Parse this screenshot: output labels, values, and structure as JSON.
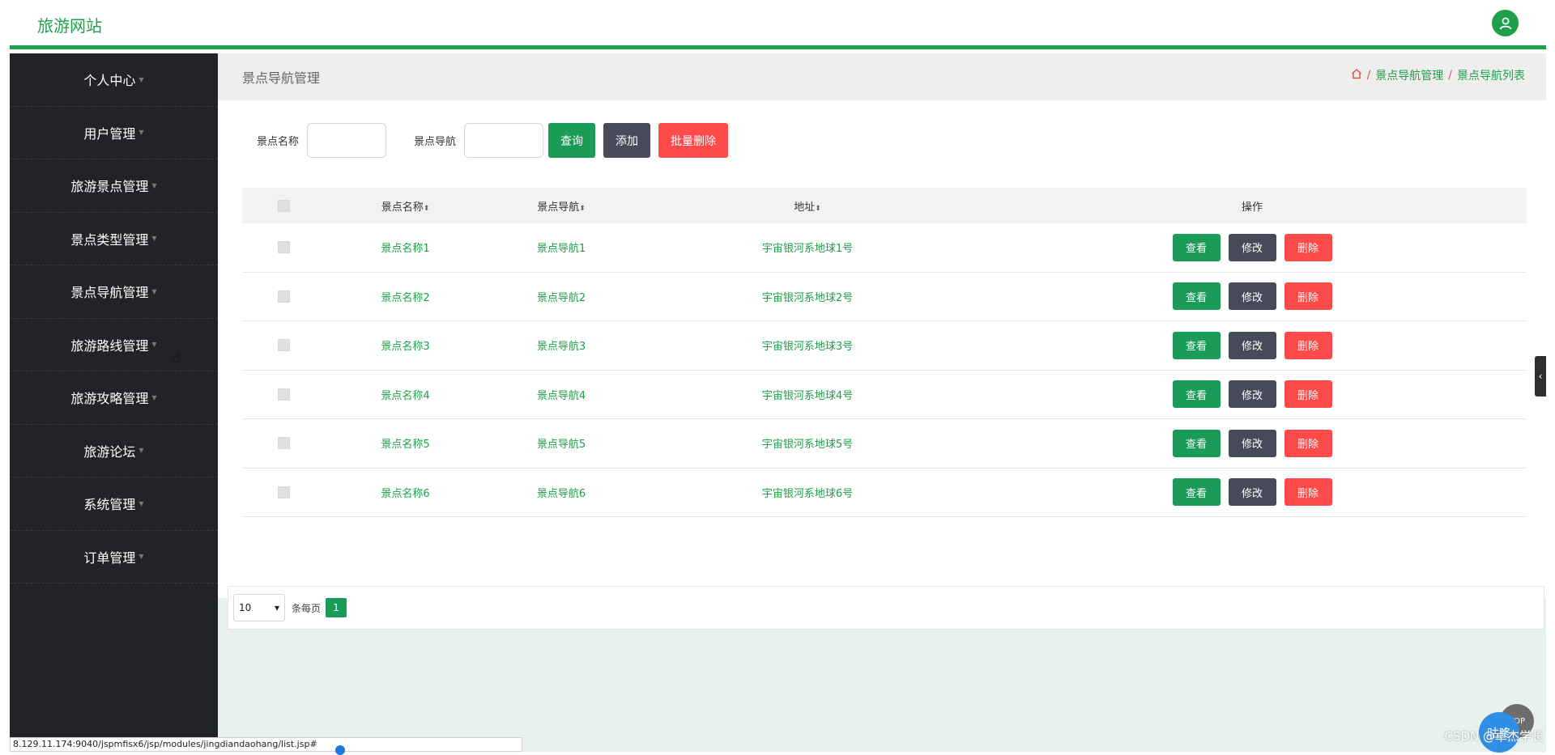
{
  "brand": "旅游网站",
  "sidebar": {
    "items": [
      {
        "label": "个人中心"
      },
      {
        "label": "用户管理"
      },
      {
        "label": "旅游景点管理"
      },
      {
        "label": "景点类型管理"
      },
      {
        "label": "景点导航管理"
      },
      {
        "label": "旅游路线管理"
      },
      {
        "label": "旅游攻略管理"
      },
      {
        "label": "旅游论坛"
      },
      {
        "label": "系统管理"
      },
      {
        "label": "订单管理"
      }
    ]
  },
  "header": {
    "page_title": "景点导航管理",
    "breadcrumb": [
      "景点导航管理",
      "景点导航列表"
    ],
    "separator": "/"
  },
  "search": {
    "name_label": "景点名称",
    "name_value": "",
    "nav_label": "景点导航",
    "nav_value": "",
    "query_button": "查询",
    "add_button": "添加",
    "batch_delete_button": "批量删除"
  },
  "table": {
    "headers": {
      "name": "景点名称",
      "nav": "景点导航",
      "address": "地址",
      "ops": "操作"
    },
    "rows": [
      {
        "name": "景点名称1",
        "nav": "景点导航1",
        "address": "宇宙银河系地球1号"
      },
      {
        "name": "景点名称2",
        "nav": "景点导航2",
        "address": "宇宙银河系地球2号"
      },
      {
        "name": "景点名称3",
        "nav": "景点导航3",
        "address": "宇宙银河系地球3号"
      },
      {
        "name": "景点名称4",
        "nav": "景点导航4",
        "address": "宇宙银河系地球4号"
      },
      {
        "name": "景点名称5",
        "nav": "景点导航5",
        "address": "宇宙银河系地球5号"
      },
      {
        "name": "景点名称6",
        "nav": "景点导航6",
        "address": "宇宙银河系地球6号"
      }
    ],
    "actions": {
      "view": "查看",
      "edit": "修改",
      "delete": "删除"
    }
  },
  "pager": {
    "page_size": "10",
    "page_size_label": "条每页",
    "current_page": "1"
  },
  "status_url": "8.129.11.174:9040/jspmfisx6/jsp/modules/jingdiandaohang/list.jsp#",
  "watermark": "CSDN @卓杰学长",
  "chat_label": "咕咚",
  "top_label": "TOP",
  "colors": {
    "accent": "#1ea04a",
    "sidebar": "#222326",
    "dark_button": "#474a59",
    "danger": "#ff4a4a"
  }
}
